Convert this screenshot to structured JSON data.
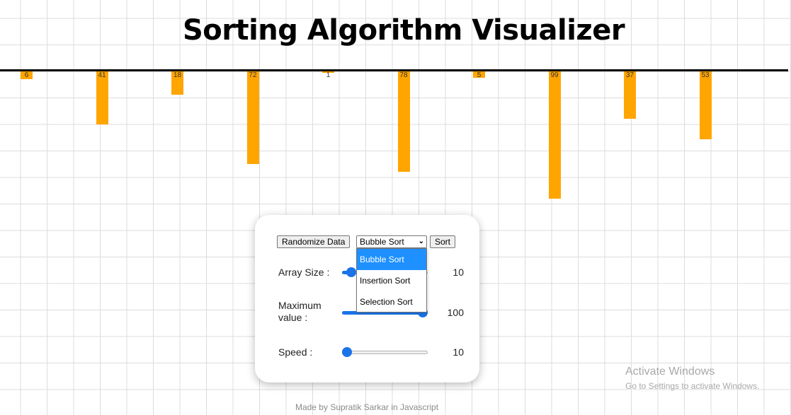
{
  "header": {
    "title": "Sorting Algorithm Visualizer"
  },
  "colors": {
    "bar": "#ffa500",
    "accent": "#1a73e8",
    "selected": "#1e90ff"
  },
  "chart_data": {
    "type": "bar",
    "values": [
      6,
      41,
      18,
      72,
      1,
      78,
      5,
      99,
      37,
      53
    ],
    "max": 100
  },
  "controls": {
    "randomize_label": "Randomize Data",
    "algorithm_selected": "Bubble Sort",
    "algorithm_options": [
      "Bubble Sort",
      "Insertion Sort",
      "Selection Sort"
    ],
    "sort_label": "Sort",
    "array_size": {
      "label": "Array Size :",
      "value": "10",
      "min": 5,
      "max": 100,
      "current": 10
    },
    "max_value": {
      "label_line1": "Maximum",
      "label_line2": "value :",
      "value": "100",
      "min": 10,
      "max": 100,
      "current": 100
    },
    "speed": {
      "label": "Speed :",
      "value": "10",
      "min": 10,
      "max": 1000,
      "current": 10
    }
  },
  "footer": {
    "credit": "Made by Supratik Sarkar in Javascript"
  },
  "watermark": {
    "title": "Activate Windows",
    "subtitle": "Go to Settings to activate Windows."
  }
}
